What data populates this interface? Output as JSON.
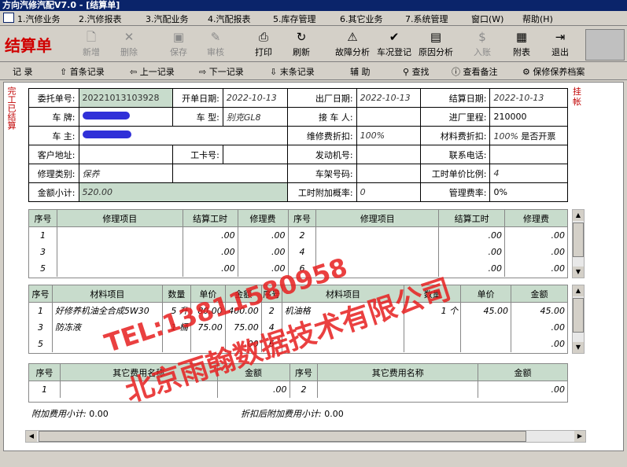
{
  "title": "方向汽修汽配V7.0 - [结算单]",
  "menu": [
    "1.汽修业务",
    "2.汽修报表",
    "3.汽配业务",
    "4.汽配报表",
    "5.库存管理",
    "6.其它业务",
    "7.系统管理",
    "窗口(W)",
    "帮助(H)"
  ],
  "toolbar": {
    "settle_label": "结算单",
    "buttons": [
      {
        "label": "新增",
        "icon": "new-doc-icon",
        "enabled": false
      },
      {
        "label": "删除",
        "icon": "delete-icon",
        "enabled": false
      },
      {
        "label": "保存",
        "icon": "save-icon",
        "enabled": false
      },
      {
        "label": "审核",
        "icon": "audit-icon",
        "enabled": false
      },
      {
        "label": "打印",
        "icon": "print-icon",
        "enabled": true
      },
      {
        "label": "刷新",
        "icon": "refresh-icon",
        "enabled": true
      },
      {
        "label": "故障分析",
        "icon": "warning-icon",
        "enabled": true
      },
      {
        "label": "车况登记",
        "icon": "car-check-icon",
        "enabled": true
      },
      {
        "label": "原因分析",
        "icon": "chart-icon",
        "enabled": true
      },
      {
        "label": "入账",
        "icon": "money-icon",
        "enabled": false
      },
      {
        "label": "附表",
        "icon": "table-icon",
        "enabled": true
      },
      {
        "label": "退出",
        "icon": "exit-icon",
        "enabled": true
      }
    ]
  },
  "nav": {
    "records": "记 录",
    "first": "首条记录",
    "prev": "上一记录",
    "next": "下一记录",
    "last": "末条记录",
    "help": "辅 助",
    "search": "查找",
    "notes": "查看备注",
    "maint": "保修保养档案"
  },
  "side": {
    "left": "完工已结算",
    "right": "挂帐"
  },
  "form": {
    "entrust_no_label": "委托单号:",
    "entrust_no": "20221013103928",
    "open_date_label": "开单日期:",
    "open_date": "2022-10-13",
    "out_date_label": "出厂日期:",
    "out_date": "2022-10-13",
    "settle_date_label": "结算日期:",
    "settle_date": "2022-10-13",
    "plate_label": "车 牌:",
    "model_label": "车 型:",
    "model": "别克GL8",
    "receiver_label": "接 车 人:",
    "mileage_label": "进厂里程:",
    "mileage": "210000",
    "owner_label": "车 主:",
    "repair_disc_label": "维修费折扣:",
    "repair_disc": "100%",
    "material_disc_label": "材料费折扣:",
    "material_disc": "100%",
    "invoice_label": "是否开票",
    "address_label": "客户地址:",
    "card_label": "工卡号:",
    "engine_label": "发动机号:",
    "phone_label": "联系电话:",
    "repair_type_label": "修理类别:",
    "repair_type": "保养",
    "vin_label": "车架号码:",
    "hour_ratio_label": "工时单价比例:",
    "hour_ratio": "4",
    "total_label": "金额小计:",
    "total": "520.00",
    "extra_rate_label": "工时附加概率:",
    "extra_rate": "0",
    "mgmt_label": "管理费率:",
    "mgmt": "0%"
  },
  "repair": {
    "headers": [
      "序号",
      "修理项目",
      "结算工时",
      "修理费",
      "序号",
      "修理项目",
      "结算工时",
      "修理费"
    ],
    "rows": [
      [
        "1",
        "",
        ".00",
        ".00",
        "2",
        "",
        ".00",
        ".00"
      ],
      [
        "3",
        "",
        ".00",
        ".00",
        "4",
        "",
        ".00",
        ".00"
      ],
      [
        "5",
        "",
        ".00",
        ".00",
        "6",
        "",
        ".00",
        ".00"
      ]
    ]
  },
  "material": {
    "headers": [
      "序号",
      "材料项目",
      "数量",
      "单价",
      "金额",
      "序号",
      "材料项目",
      "数量",
      "单价",
      "金额"
    ],
    "rows": [
      [
        "1",
        "好修养机油全合成5W30",
        "5 升",
        "80.00",
        "400.00",
        "2",
        "机油格",
        "1 个",
        "45.00",
        "45.00"
      ],
      [
        "3",
        "防冻液",
        "1 桶",
        "75.00",
        "75.00",
        "4",
        "",
        "",
        "",
        ".00"
      ],
      [
        "5",
        "",
        "",
        "",
        ".00",
        "6",
        "",
        "",
        "",
        ".00"
      ]
    ]
  },
  "other": {
    "headers": [
      "序号",
      "其它费用名称",
      "金额",
      "序号",
      "其它费用名称",
      "金额"
    ],
    "rows": [
      [
        "1",
        "",
        ".00",
        "2",
        "",
        ".00"
      ]
    ]
  },
  "footer": {
    "extra_label": "附加费用小计:",
    "extra": "0.00",
    "disc_label": "折扣后附加费用小计:",
    "disc": "0.00"
  },
  "watermark": {
    "tel": "TEL:13811580958",
    "company": "北京雨翰数据技术有限公司"
  }
}
